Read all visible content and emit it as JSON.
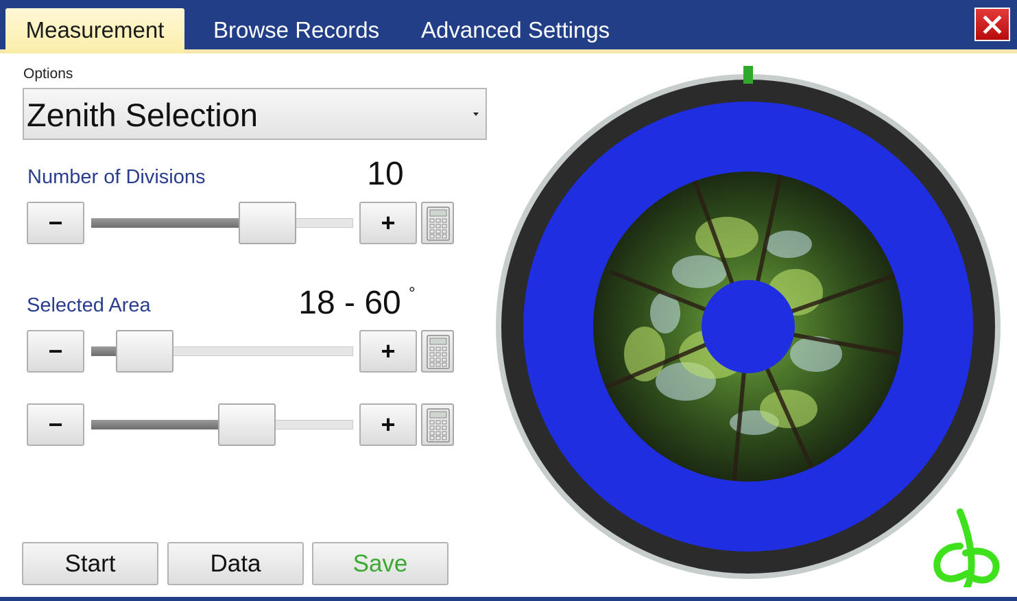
{
  "tabs": {
    "measurement": "Measurement",
    "browse_records": "Browse Records",
    "advanced_settings": "Advanced Settings"
  },
  "options": {
    "label": "Options",
    "selected": "Zenith Selection"
  },
  "divisions": {
    "label": "Number of Divisions",
    "value": "10",
    "slider_fraction": 0.72
  },
  "selected_area": {
    "label": "Selected Area",
    "value": "18 - 60",
    "unit": "°",
    "min_slider_fraction": 0.12,
    "max_slider_fraction": 0.62
  },
  "buttons": {
    "minus": "−",
    "plus": "+",
    "start": "Start",
    "data": "Data",
    "save": "Save"
  },
  "colors": {
    "header_bg": "#213e87",
    "active_tab": "#fbeea9",
    "label_blue": "#2a3e8d",
    "overlay_blue": "#1f2ee0",
    "save_green": "#3aaa32",
    "logo_green": "#3fe11c",
    "close_red": "#d11f1f"
  },
  "icons": {
    "close": "close-icon",
    "calculator": "calculator-icon",
    "logo": "leaf-logo-icon"
  }
}
